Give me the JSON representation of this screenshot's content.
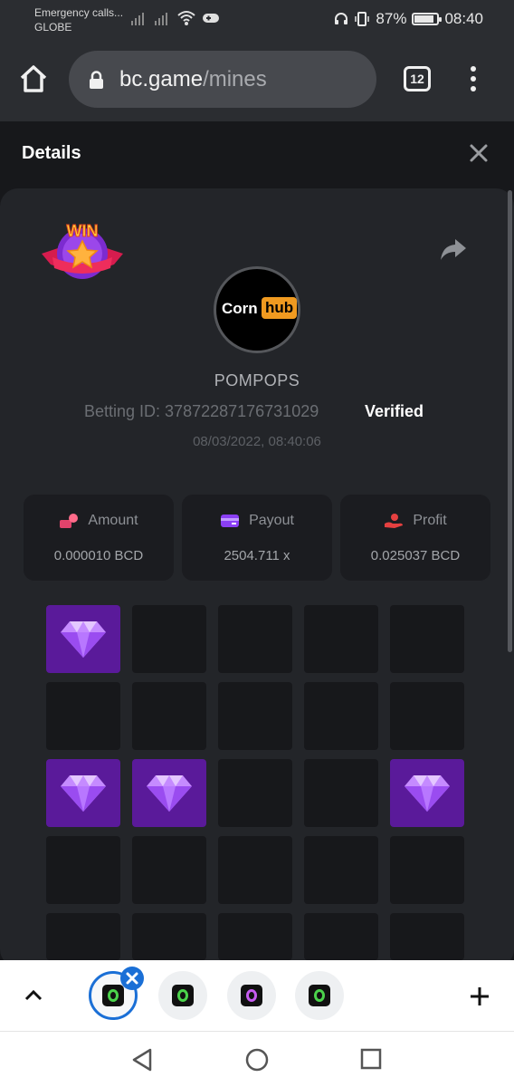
{
  "status_bar": {
    "carrier_line1": "Emergency calls...",
    "carrier_line2": "GLOBE",
    "battery": "87%",
    "battery_level": 0.87,
    "time": "08:40"
  },
  "browser": {
    "url_host": "bc.game",
    "url_path": "/mines",
    "tab_count": "12"
  },
  "details": {
    "title": "Details",
    "username": "POMPOPS",
    "betting_id_label": "Betting ID: 37872287176731029",
    "verified": "Verified",
    "timestamp": "08/03/2022, 08:40:06",
    "avatar_text_1": "Corn",
    "avatar_text_2": "hub",
    "win_badge_text": "WIN"
  },
  "stats": [
    {
      "label": "Amount",
      "value": "0.000010 BCD",
      "icon": "amount-icon",
      "color": "#e0436b"
    },
    {
      "label": "Payout",
      "value": "2504.711 x",
      "icon": "payout-icon",
      "color": "#8b3ff5"
    },
    {
      "label": "Profit",
      "value": "0.025037 BCD",
      "icon": "profit-icon",
      "color": "#e54040"
    }
  ],
  "mines_grid": {
    "columns": 5,
    "rows_visible": 5,
    "gem_tiles": [
      [
        0,
        0
      ],
      [
        2,
        0
      ],
      [
        2,
        1
      ],
      [
        2,
        4
      ]
    ]
  },
  "colors": {
    "gem_tile": "#5a1a9a",
    "accent_blue": "#1a6fd6",
    "brand_green": "#4bd34b"
  }
}
